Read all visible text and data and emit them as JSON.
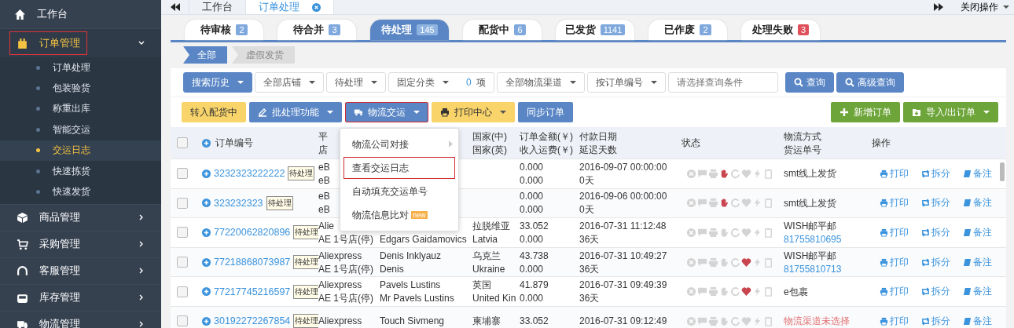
{
  "sidebar": {
    "home": "工作台",
    "menus": [
      {
        "label": "订单管理",
        "expanded": true,
        "highlighted": true,
        "children": [
          {
            "label": "订单处理",
            "selected": false
          },
          {
            "label": "包装验货",
            "selected": false
          },
          {
            "label": "称重出库",
            "selected": false
          },
          {
            "label": "智能交运",
            "selected": false
          },
          {
            "label": "交运日志",
            "selected": true
          },
          {
            "label": "快速拣货",
            "selected": false
          },
          {
            "label": "快速发货",
            "selected": false
          }
        ]
      },
      {
        "label": "商品管理",
        "expanded": false,
        "highlighted": false
      },
      {
        "label": "采购管理",
        "expanded": false,
        "highlighted": false
      },
      {
        "label": "客服管理",
        "expanded": false,
        "highlighted": false
      },
      {
        "label": "库存管理",
        "expanded": false,
        "highlighted": false
      },
      {
        "label": "物流管理",
        "expanded": false,
        "highlighted": false
      }
    ]
  },
  "page_tabs": [
    {
      "label": "工作台",
      "selected": false,
      "closable": false
    },
    {
      "label": "订单处理",
      "selected": true,
      "closable": true
    }
  ],
  "close_menu": "关闭操作",
  "status_tabs": [
    {
      "label": "待审核",
      "count": "2",
      "selected": false,
      "color": "#7fa9dd"
    },
    {
      "label": "待合并",
      "count": "3",
      "selected": false,
      "color": "#7fa9dd"
    },
    {
      "label": "待处理",
      "count": "145",
      "selected": true,
      "color": "#8fb3e0"
    },
    {
      "label": "配货中",
      "count": "6",
      "selected": false,
      "color": "#7fa9dd"
    },
    {
      "label": "已发货",
      "count": "1141",
      "selected": false,
      "color": "#7fa9dd"
    },
    {
      "label": "已作废",
      "count": "2",
      "selected": false,
      "color": "#7fa9dd"
    },
    {
      "label": "处理失败",
      "count": "3",
      "selected": false,
      "color": "#e0505a"
    }
  ],
  "sub_tabs": [
    {
      "label": "全部",
      "selected": true
    },
    {
      "label": "虚假发货",
      "selected": false
    }
  ],
  "filters": [
    {
      "label": "搜索历史",
      "kind": "primary"
    },
    {
      "label": "全部店铺",
      "kind": "select"
    },
    {
      "label": "待处理",
      "kind": "select"
    },
    {
      "label": "固定分类",
      "kind": "count",
      "count": "0",
      "unit": "项"
    },
    {
      "label": "全部物流渠道",
      "kind": "select"
    },
    {
      "label": "按订单编号",
      "kind": "select"
    }
  ],
  "search": {
    "placeholder": "请选择查询条件",
    "buttons": [
      "查询",
      "高级查询"
    ]
  },
  "actions": [
    {
      "label": "转入配货中",
      "highlighted": false
    },
    {
      "label": "批处理功能",
      "highlighted": false
    },
    {
      "label": "物流交运",
      "highlighted": true
    },
    {
      "label": "打印中心",
      "highlighted": false
    },
    {
      "label": "同步订单",
      "highlighted": false
    }
  ],
  "right_actions": [
    "新增订单",
    "导入/出订单"
  ],
  "dropdown": [
    {
      "label": "物流公司对接",
      "submenu": true,
      "highlighted": false
    },
    {
      "label": "查看交运日志",
      "submenu": false,
      "highlighted": true
    },
    {
      "label": "自动填充交运单号",
      "submenu": false,
      "highlighted": false
    },
    {
      "label": "物流信息比对",
      "submenu": false,
      "highlighted": false,
      "badge": "new"
    }
  ],
  "table": {
    "checked": false,
    "columns": [
      [
        "订单编号"
      ],
      [
        "平",
        "店"
      ],
      [],
      [
        "国家(中)",
        "国家(英)"
      ],
      [
        "订单金额(￥)",
        "收入运费(￥)"
      ],
      [
        "付款日期",
        "延迟天数"
      ],
      [
        "状态"
      ],
      [
        "物流方式",
        "货运单号"
      ],
      [
        "操作"
      ]
    ],
    "rows": [
      {
        "checked": false,
        "order": "3232323222222",
        "tag": "待处理",
        "platform": {
          "line_1": "eB",
          "line_2": "eB"
        },
        "buyer": {},
        "country": {},
        "amount": {
          "line_1": "0.000",
          "line_2": "0.000"
        },
        "date": {
          "line_1": "2016-09-07 00:00:00",
          "line_2": "0天"
        },
        "hold": true,
        "heart": false,
        "logistics": {
          "kind": "method",
          "method": "smt线上发货"
        },
        "actions": [
          "打印",
          "拆分",
          "备注"
        ]
      },
      {
        "checked": false,
        "order": "323232323",
        "tag": "待处理",
        "platform": {
          "line_1": "eB",
          "line_2": "eB"
        },
        "buyer": {},
        "country": {},
        "amount": {
          "line_1": "0.000",
          "line_2": "0.000"
        },
        "date": {
          "line_1": "2016-09-06 00:00:00",
          "line_2": "0天"
        },
        "hold": true,
        "heart": false,
        "logistics": {
          "kind": "method",
          "method": "smt线上发货"
        },
        "actions": [
          "打印",
          "拆分",
          "备注"
        ]
      },
      {
        "checked": false,
        "order": "77220062820896",
        "tag": "待处理",
        "platform": {
          "line_1": "Alie",
          "line_2": "AE 1号店(停)"
        },
        "buyer": {
          "line_2": "Edgars Gaidamovics"
        },
        "country": {
          "line_1": "拉脱维亚",
          "line_2": "Latvia"
        },
        "amount": {
          "line_1": "33.052",
          "line_2": "0.000"
        },
        "date": {
          "line_1": "2016-07-31 11:12:48",
          "line_2": "36天"
        },
        "hold": false,
        "heart": false,
        "logistics": {
          "kind": "method",
          "method": "WISH邮平邮",
          "tracking": "81755810695"
        },
        "actions": [
          "打印",
          "拆分",
          "备注"
        ]
      },
      {
        "checked": false,
        "order": "77218868073987",
        "tag": "待处理",
        "platform": {
          "line_1": "Aliexpress",
          "line_2": "AE 1号店(停)"
        },
        "buyer": {
          "line_1": "Denis Inklyauz",
          "line_2": "Denis"
        },
        "country": {
          "line_1": "乌克兰",
          "line_2": "Ukraine"
        },
        "amount": {
          "line_1": "43.738",
          "line_2": "0.000"
        },
        "date": {
          "line_1": "2016-07-31 10:49:27",
          "line_2": "36天"
        },
        "hold": false,
        "heart": true,
        "logistics": {
          "kind": "method",
          "method": "WISH邮平邮",
          "tracking": "81755810713"
        },
        "actions": [
          "打印",
          "拆分",
          "备注"
        ]
      },
      {
        "checked": false,
        "order": "77217745216597",
        "tag": "待处理",
        "platform": {
          "line_1": "Aliexpress",
          "line_2": "AE 1号店(停)"
        },
        "buyer": {
          "line_1": "Pavels Lustins",
          "line_2": "Mr Pavels Lustins"
        },
        "country": {
          "line_1": "英国",
          "line_2": "United Kin"
        },
        "amount": {
          "line_1": "41.879",
          "line_2": "0.000"
        },
        "date": {
          "line_1": "2016-07-31 09:49:39",
          "line_2": "36天"
        },
        "hold": false,
        "heart": true,
        "logistics": {
          "kind": "method",
          "method": "e包裹"
        },
        "actions": [
          "打印",
          "拆分",
          "备注"
        ]
      },
      {
        "checked": false,
        "order": "30192272267854",
        "tag": "待处理",
        "platform": {
          "line_1": "Aliexpress"
        },
        "buyer": {
          "line_1": "Touch Sivmeng"
        },
        "country": {
          "line_1": "柬埔寨"
        },
        "amount": {
          "line_1": "33.052"
        },
        "date": {
          "line_1": "2016-07-31 09:12:49"
        },
        "hold": false,
        "heart": false,
        "logistics": {
          "kind": "warning",
          "method": "物流渠道未选择"
        },
        "actions": [
          "打印",
          "拆分",
          "备注"
        ]
      }
    ]
  }
}
